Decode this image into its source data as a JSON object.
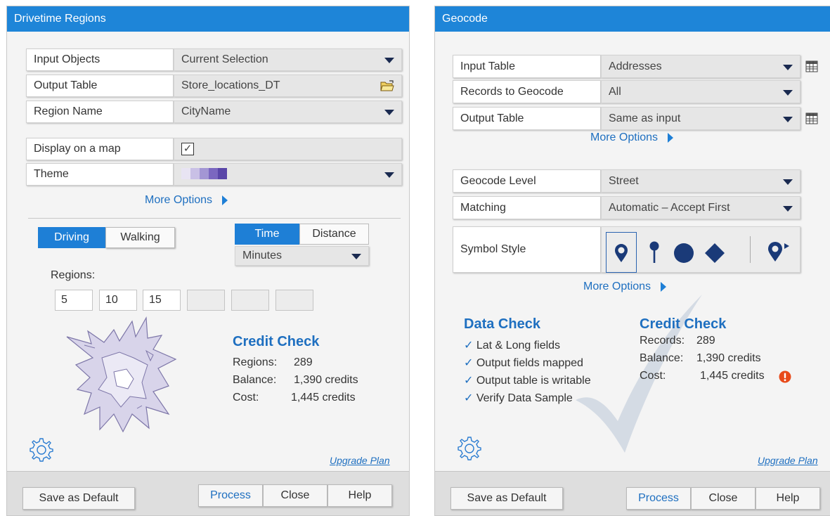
{
  "left": {
    "title": "Drivetime Regions",
    "rows": [
      {
        "label": "Input Objects",
        "value": "Current Selection"
      },
      {
        "label": "Output Table",
        "value": "Store_locations_DT"
      },
      {
        "label": "Region Name",
        "value": "CityName"
      },
      {
        "label": "Display on a map",
        "value": "✓"
      },
      {
        "label": "Theme",
        "value": ""
      }
    ],
    "theme_colors": [
      "#e8e4f3",
      "#c9c0e6",
      "#a396d4",
      "#7b67c0",
      "#5a46a8"
    ],
    "more_options": "More Options",
    "mode_tabs": [
      "Driving",
      "Walking"
    ],
    "measure_tabs": [
      "Time",
      "Distance"
    ],
    "unit": "Minutes",
    "regions_label": "Regions:",
    "regions": [
      "5",
      "10",
      "15",
      "",
      "",
      ""
    ],
    "credit": {
      "title": "Credit Check",
      "lines": [
        {
          "k": "Regions:",
          "v": "289"
        },
        {
          "k": "Balance:",
          "v": "1,390 credits"
        },
        {
          "k": "Cost:",
          "v": "1,445 credits"
        }
      ]
    },
    "upgrade": "Upgrade Plan",
    "footer": {
      "save": "Save as Default",
      "process": "Process",
      "close": "Close",
      "help": "Help"
    }
  },
  "right": {
    "title": "Geocode",
    "rows_top": [
      {
        "label": "Input Table",
        "value": "Addresses"
      },
      {
        "label": "Records to Geocode",
        "value": "All"
      },
      {
        "label": "Output Table",
        "value": "Same as input"
      }
    ],
    "more_options_1": "More Options",
    "rows_mid": [
      {
        "label": "Geocode Level",
        "value": "Street"
      },
      {
        "label": "Matching",
        "value": "Automatic – Accept First"
      }
    ],
    "symbol_label": "Symbol Style",
    "more_options_2": "More Options",
    "data_check": {
      "title": "Data Check",
      "items": [
        "Lat & Long fields",
        "Output fields mapped",
        "Output table is writable",
        "Verify Data Sample"
      ]
    },
    "credit": {
      "title": "Credit Check",
      "lines": [
        {
          "k": "Records:",
          "v": "289"
        },
        {
          "k": "Balance:",
          "v": "1,390 credits"
        },
        {
          "k": "Cost:",
          "v": "1,445 credits"
        }
      ]
    },
    "upgrade": "Upgrade Plan",
    "footer": {
      "save": "Save as Default",
      "process": "Process",
      "close": "Close",
      "help": "Help"
    }
  },
  "colors": {
    "accent": "#1e85d8",
    "link": "#1e6fc0",
    "warning": "#e84a1a"
  }
}
